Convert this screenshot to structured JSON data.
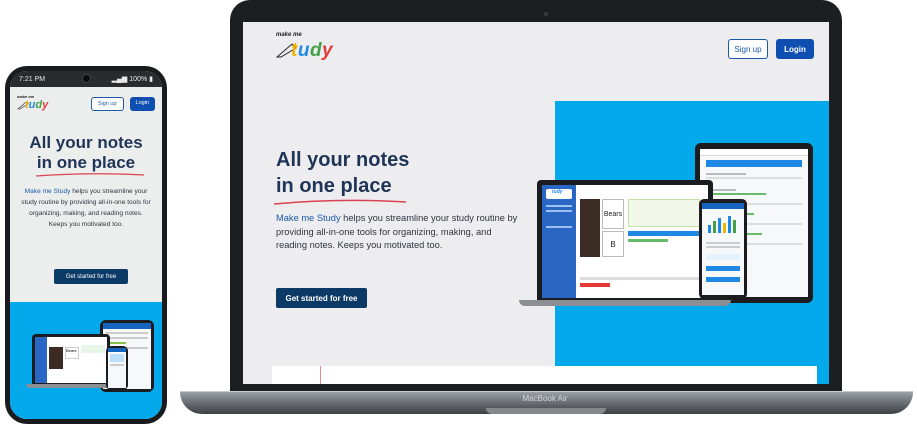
{
  "brand": {
    "tagline": "make me",
    "name": "Study",
    "letter_colors": [
      "#e23b3b",
      "#f4b400",
      "#1e88e5",
      "#43a047",
      "#8e24aa"
    ]
  },
  "nav": {
    "signup_label": "Sign up",
    "login_label": "Login"
  },
  "hero": {
    "title_line1": "All your notes",
    "title_line2": "in one place",
    "description_highlight": "Make me Study",
    "description_rest": " helps you streamline your study routine by providing all-in-one tools for organizing, making, and reading notes. Keeps you motivated too.",
    "cta_label": "Get started for free"
  },
  "phone_status": {
    "time": "7:21 PM",
    "battery": "100%"
  },
  "laptop": {
    "model_label": "MacBook Air"
  },
  "mockup": {
    "flashcard_word": "Bears",
    "flashcard_letter": "B"
  },
  "colors": {
    "accent_blue": "#04a9ec",
    "brand_navy": "#1f3456",
    "button_blue": "#0e4fb1",
    "cta_navy": "#0c3a66",
    "underline_red": "#d9434f"
  }
}
